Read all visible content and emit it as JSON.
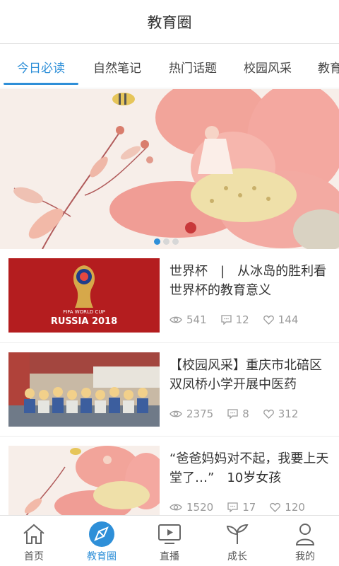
{
  "header": {
    "title": "教育圈"
  },
  "tabs": [
    {
      "label": "今日必读",
      "active": true
    },
    {
      "label": "自然笔记",
      "active": false
    },
    {
      "label": "热门话题",
      "active": false
    },
    {
      "label": "校园风采",
      "active": false
    },
    {
      "label": "教育",
      "active": false
    }
  ],
  "banner": {
    "dots": 3,
    "active_dot": 0
  },
  "articles": [
    {
      "title": "世界杯　|　从冰岛的胜利看世界杯的教育意义",
      "thumb_text_1": "FIFA WORLD CUP",
      "thumb_text_2": "RUSSIA 2018",
      "views": "541",
      "comments": "12",
      "likes": "144"
    },
    {
      "title": "【校园风采】重庆市北碚区双凤桥小学开展中医药",
      "views": "2375",
      "comments": "8",
      "likes": "312"
    },
    {
      "title": "“爸爸妈妈对不起，我要上天堂了…”　10岁女孩",
      "views": "1520",
      "comments": "17",
      "likes": "120"
    }
  ],
  "tabbar": {
    "items": [
      {
        "label": "首页",
        "icon": "home-icon",
        "active": false
      },
      {
        "label": "教育圈",
        "icon": "compass-icon",
        "active": true
      },
      {
        "label": "直播",
        "icon": "play-screen-icon",
        "active": false
      },
      {
        "label": "成长",
        "icon": "sprout-icon",
        "active": false
      },
      {
        "label": "我的",
        "icon": "user-icon",
        "active": false
      }
    ]
  },
  "colors": {
    "accent": "#2e8fd8",
    "text": "#333333",
    "meta": "#9a9a9a"
  }
}
